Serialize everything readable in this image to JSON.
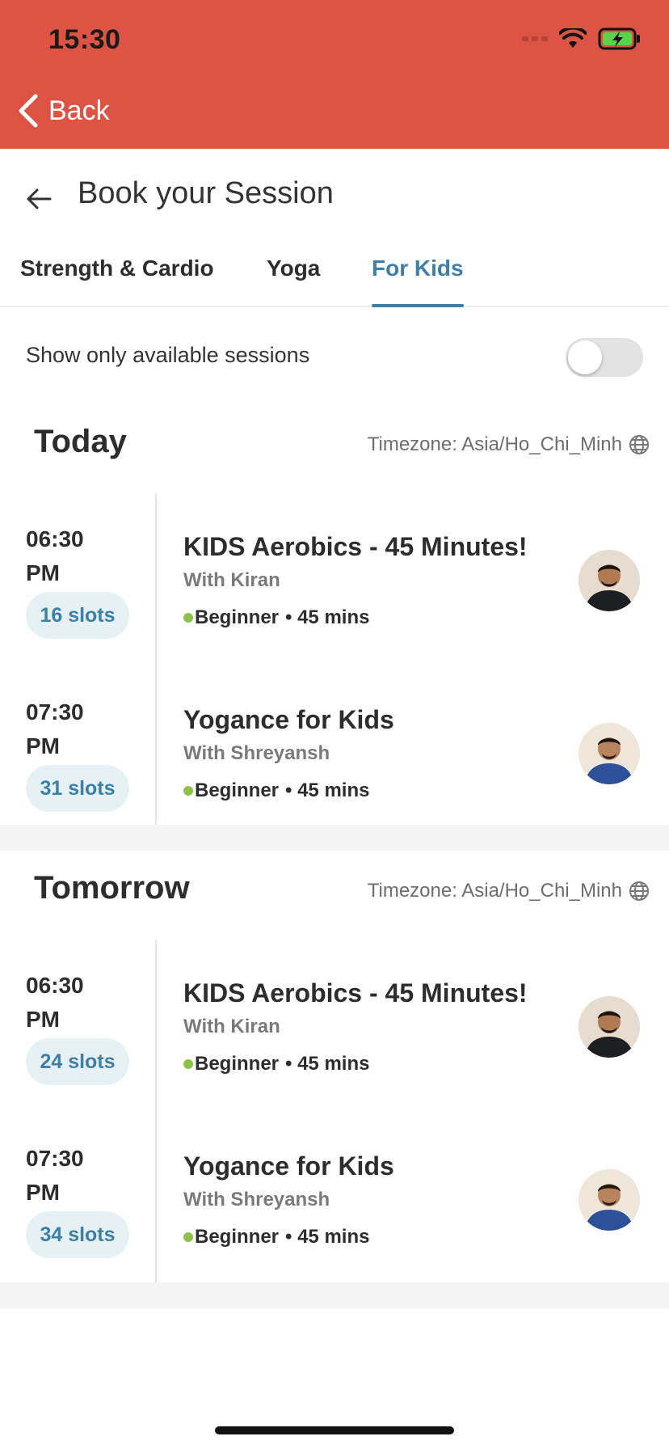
{
  "status_bar": {
    "time": "15:30"
  },
  "nav": {
    "back_label": "Back"
  },
  "header": {
    "title": "Book your Session"
  },
  "tabs": [
    {
      "label": "Strength & Cardio",
      "active": false
    },
    {
      "label": "Yoga",
      "active": false
    },
    {
      "label": "For Kids",
      "active": true
    }
  ],
  "filter": {
    "label": "Show only available sessions",
    "enabled": false
  },
  "colors": {
    "header_red": "#dd5444",
    "accent_blue": "#3d7fa6",
    "level_green": "#8bc34a"
  },
  "days": [
    {
      "title": "Today",
      "timezone": "Timezone: Asia/Ho_Chi_Minh",
      "sessions": [
        {
          "time_line1": "06:30",
          "time_line2": "PM",
          "slots": "16 slots",
          "title": "KIDS Aerobics - 45 Minutes!",
          "with": "With Kiran",
          "level": "Beginner",
          "duration": "• 45 mins",
          "avatar": "instructor-kiran"
        },
        {
          "time_line1": "07:30",
          "time_line2": "PM",
          "slots": "31 slots",
          "title": "Yogance for Kids",
          "with": "With Shreyansh",
          "level": "Beginner",
          "duration": "• 45 mins",
          "avatar": "instructor-shreyansh"
        }
      ]
    },
    {
      "title": "Tomorrow",
      "timezone": "Timezone: Asia/Ho_Chi_Minh",
      "sessions": [
        {
          "time_line1": "06:30",
          "time_line2": "PM",
          "slots": "24 slots",
          "title": "KIDS Aerobics - 45 Minutes!",
          "with": "With Kiran",
          "level": "Beginner",
          "duration": "• 45 mins",
          "avatar": "instructor-kiran"
        },
        {
          "time_line1": "07:30",
          "time_line2": "PM",
          "slots": "34 slots",
          "title": "Yogance for Kids",
          "with": "With Shreyansh",
          "level": "Beginner",
          "duration": "• 45 mins",
          "avatar": "instructor-shreyansh"
        }
      ]
    }
  ]
}
